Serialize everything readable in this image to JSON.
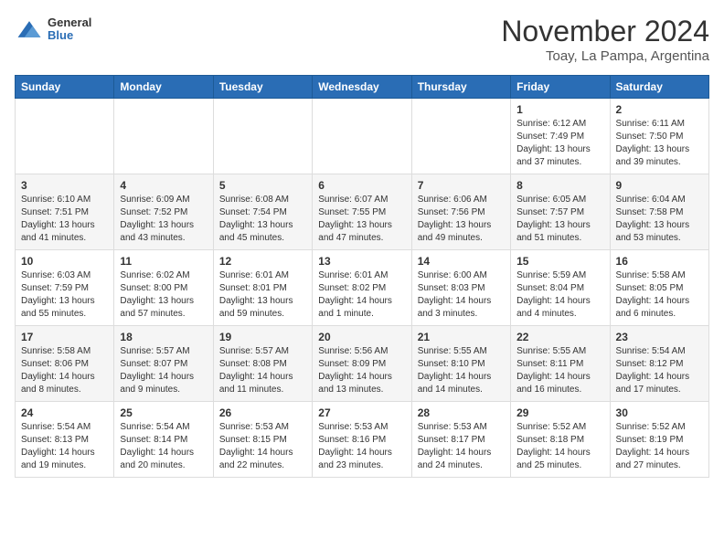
{
  "header": {
    "logo_general": "General",
    "logo_blue": "Blue",
    "title": "November 2024",
    "subtitle": "Toay, La Pampa, Argentina"
  },
  "weekdays": [
    "Sunday",
    "Monday",
    "Tuesday",
    "Wednesday",
    "Thursday",
    "Friday",
    "Saturday"
  ],
  "weeks": [
    [
      {
        "day": "",
        "info": ""
      },
      {
        "day": "",
        "info": ""
      },
      {
        "day": "",
        "info": ""
      },
      {
        "day": "",
        "info": ""
      },
      {
        "day": "",
        "info": ""
      },
      {
        "day": "1",
        "info": "Sunrise: 6:12 AM\nSunset: 7:49 PM\nDaylight: 13 hours and 37 minutes."
      },
      {
        "day": "2",
        "info": "Sunrise: 6:11 AM\nSunset: 7:50 PM\nDaylight: 13 hours and 39 minutes."
      }
    ],
    [
      {
        "day": "3",
        "info": "Sunrise: 6:10 AM\nSunset: 7:51 PM\nDaylight: 13 hours and 41 minutes."
      },
      {
        "day": "4",
        "info": "Sunrise: 6:09 AM\nSunset: 7:52 PM\nDaylight: 13 hours and 43 minutes."
      },
      {
        "day": "5",
        "info": "Sunrise: 6:08 AM\nSunset: 7:54 PM\nDaylight: 13 hours and 45 minutes."
      },
      {
        "day": "6",
        "info": "Sunrise: 6:07 AM\nSunset: 7:55 PM\nDaylight: 13 hours and 47 minutes."
      },
      {
        "day": "7",
        "info": "Sunrise: 6:06 AM\nSunset: 7:56 PM\nDaylight: 13 hours and 49 minutes."
      },
      {
        "day": "8",
        "info": "Sunrise: 6:05 AM\nSunset: 7:57 PM\nDaylight: 13 hours and 51 minutes."
      },
      {
        "day": "9",
        "info": "Sunrise: 6:04 AM\nSunset: 7:58 PM\nDaylight: 13 hours and 53 minutes."
      }
    ],
    [
      {
        "day": "10",
        "info": "Sunrise: 6:03 AM\nSunset: 7:59 PM\nDaylight: 13 hours and 55 minutes."
      },
      {
        "day": "11",
        "info": "Sunrise: 6:02 AM\nSunset: 8:00 PM\nDaylight: 13 hours and 57 minutes."
      },
      {
        "day": "12",
        "info": "Sunrise: 6:01 AM\nSunset: 8:01 PM\nDaylight: 13 hours and 59 minutes."
      },
      {
        "day": "13",
        "info": "Sunrise: 6:01 AM\nSunset: 8:02 PM\nDaylight: 14 hours and 1 minute."
      },
      {
        "day": "14",
        "info": "Sunrise: 6:00 AM\nSunset: 8:03 PM\nDaylight: 14 hours and 3 minutes."
      },
      {
        "day": "15",
        "info": "Sunrise: 5:59 AM\nSunset: 8:04 PM\nDaylight: 14 hours and 4 minutes."
      },
      {
        "day": "16",
        "info": "Sunrise: 5:58 AM\nSunset: 8:05 PM\nDaylight: 14 hours and 6 minutes."
      }
    ],
    [
      {
        "day": "17",
        "info": "Sunrise: 5:58 AM\nSunset: 8:06 PM\nDaylight: 14 hours and 8 minutes."
      },
      {
        "day": "18",
        "info": "Sunrise: 5:57 AM\nSunset: 8:07 PM\nDaylight: 14 hours and 9 minutes."
      },
      {
        "day": "19",
        "info": "Sunrise: 5:57 AM\nSunset: 8:08 PM\nDaylight: 14 hours and 11 minutes."
      },
      {
        "day": "20",
        "info": "Sunrise: 5:56 AM\nSunset: 8:09 PM\nDaylight: 14 hours and 13 minutes."
      },
      {
        "day": "21",
        "info": "Sunrise: 5:55 AM\nSunset: 8:10 PM\nDaylight: 14 hours and 14 minutes."
      },
      {
        "day": "22",
        "info": "Sunrise: 5:55 AM\nSunset: 8:11 PM\nDaylight: 14 hours and 16 minutes."
      },
      {
        "day": "23",
        "info": "Sunrise: 5:54 AM\nSunset: 8:12 PM\nDaylight: 14 hours and 17 minutes."
      }
    ],
    [
      {
        "day": "24",
        "info": "Sunrise: 5:54 AM\nSunset: 8:13 PM\nDaylight: 14 hours and 19 minutes."
      },
      {
        "day": "25",
        "info": "Sunrise: 5:54 AM\nSunset: 8:14 PM\nDaylight: 14 hours and 20 minutes."
      },
      {
        "day": "26",
        "info": "Sunrise: 5:53 AM\nSunset: 8:15 PM\nDaylight: 14 hours and 22 minutes."
      },
      {
        "day": "27",
        "info": "Sunrise: 5:53 AM\nSunset: 8:16 PM\nDaylight: 14 hours and 23 minutes."
      },
      {
        "day": "28",
        "info": "Sunrise: 5:53 AM\nSunset: 8:17 PM\nDaylight: 14 hours and 24 minutes."
      },
      {
        "day": "29",
        "info": "Sunrise: 5:52 AM\nSunset: 8:18 PM\nDaylight: 14 hours and 25 minutes."
      },
      {
        "day": "30",
        "info": "Sunrise: 5:52 AM\nSunset: 8:19 PM\nDaylight: 14 hours and 27 minutes."
      }
    ]
  ]
}
